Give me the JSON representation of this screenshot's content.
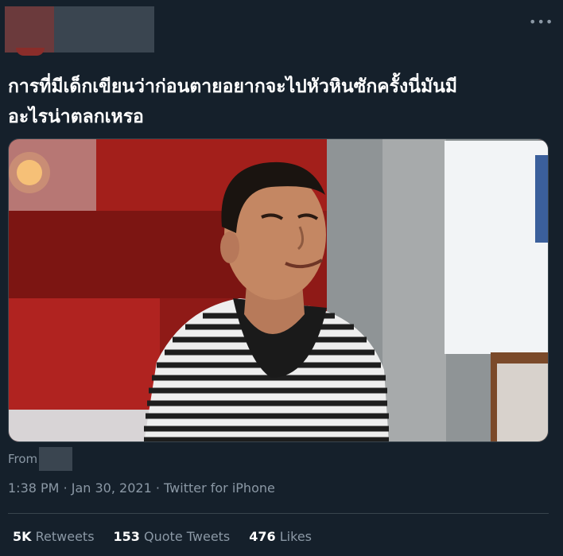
{
  "tweet": {
    "text": "การที่มีเด็กเขียนว่าก่อนตายอยากจะไปหัวหินซักครั้งนี่มันมี\nอะไรน่าตลกเหรอ",
    "more_icon": "more-horizontal-icon",
    "more_glyph": "•••",
    "from_label": "From",
    "time": "1:38 PM",
    "separator": "·",
    "date": "Jan 30, 2021",
    "source": "Twitter for iPhone"
  },
  "stats": {
    "retweets_count": "5K",
    "retweets_label": "Retweets",
    "quotes_count": "153",
    "quotes_label": "Quote Tweets",
    "likes_count": "476",
    "likes_label": "Likes"
  },
  "colors": {
    "background": "#15202b",
    "text": "#ffffff",
    "secondary": "#8b98a5",
    "divider": "#38444d"
  }
}
